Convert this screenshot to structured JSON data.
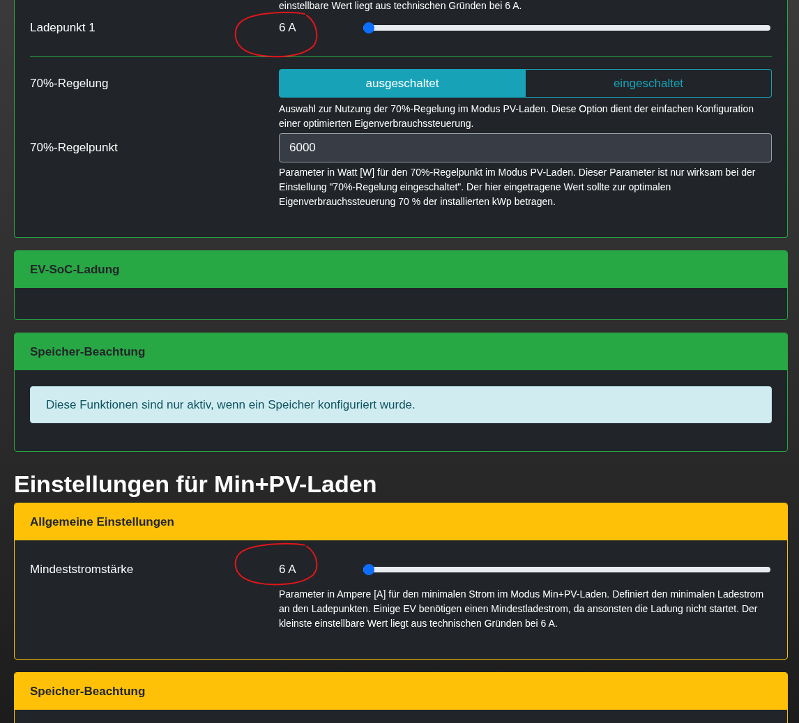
{
  "groups": [
    {
      "cards": [
        {
          "color": "#28a745",
          "items": [
            {
              "kind": "help",
              "text": "einstellbare Wert liegt aus technischen Gründen bei 6 A."
            },
            {
              "kind": "range",
              "label": "Ladepunkt 1",
              "value": "6 A",
              "level": 0,
              "circled": true
            },
            {
              "kind": "divider"
            },
            {
              "kind": "toggle",
              "label": "70%-Regelung",
              "options": [
                {
                  "label": "ausgeschaltet",
                  "selected": true
                },
                {
                  "label": "eingeschaltet",
                  "selected": false
                }
              ],
              "help": "Auswahl zur Nutzung der 70%-Regelung im Modus PV-Laden. Diese Option dient der einfachen Konfiguration einer optimierten Eigenverbrauchssteuerung."
            },
            {
              "kind": "number",
              "label": "70%-Regelpunkt",
              "value": "6000",
              "help": "Parameter in Watt [W] für den 70%-Regelpunkt im Modus PV-Laden. Dieser Parameter ist nur wirksam bei der Einstellung \"70%-Regelung eingeschaltet\". Der hier eingetragene Wert sollte zur optimalen Eigenverbrauchssteuerung 70 % der installierten kWp betragen."
            }
          ]
        },
        {
          "title": "EV-SoC-Ladung",
          "color": "#28a745"
        },
        {
          "title": "Speicher-Beachtung",
          "color": "#28a745",
          "items": [
            {
              "kind": "alert",
              "text": "Diese Funktionen sind nur aktiv, wenn ein Speicher konfiguriert wurde."
            }
          ]
        }
      ]
    },
    {
      "heading": "Einstellungen für Min+PV-Laden",
      "cards": [
        {
          "title": "Allgemeine Einstellungen",
          "color": "#ffc107",
          "items": [
            {
              "kind": "range",
              "label": "Mindeststromstärke",
              "value": "6 A",
              "level": 0,
              "circled": true,
              "help": "Parameter in Ampere [A] für den minimalen Strom im Modus Min+PV-Laden. Definiert den minimalen Ladestrom an den Ladepunkten. Einige EV benötigen einen Mindestladestrom, da ansonsten die Ladung nicht startet. Der kleinste einstellbare Wert liegt aus technischen Gründen bei 6 A."
            }
          ]
        },
        {
          "title": "Speicher-Beachtung",
          "color": "#ffc107"
        }
      ]
    }
  ]
}
